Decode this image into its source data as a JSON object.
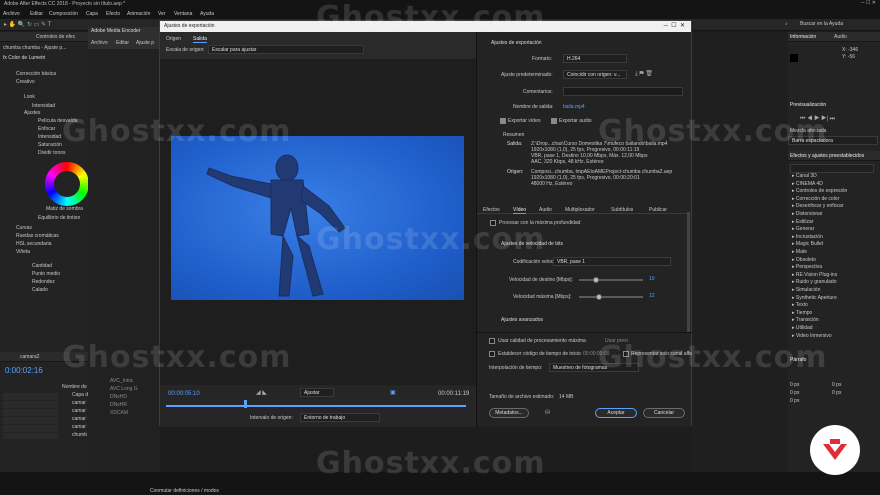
{
  "app": {
    "title": "Adobe After Effects CC 2018 - Proyecto sin título.aep *",
    "menu": [
      "Archivo",
      "Editar",
      "Composición",
      "Capa",
      "Efecto",
      "Animación",
      "Ver",
      "Ventana",
      "Ayuda"
    ],
    "search_placeholder": "Buscar en la Ayuda"
  },
  "ame": {
    "title": "Adobe Media Encoder",
    "menu": [
      "Archivo",
      "Editar",
      "Ajuste p"
    ]
  },
  "effects": {
    "tab": "Controles de efec",
    "breadcrumb": "chumba chumba - Ajuste p...",
    "effect": "Color de Lumetri",
    "items": [
      "Corrección básica",
      "Creativo",
      "Look",
      "Intensidad",
      "Ajustes",
      "Película desvaída",
      "Enfocar",
      "Intensidad",
      "Saturación",
      "Dividir tonos",
      "Matiz de sombra",
      "Equilibrio de tintion",
      "Curvas",
      "Ruedas cromáticas",
      "HSL secundaria",
      "Viñeta",
      "Cantidad",
      "Punto medio",
      "Redondez",
      "Calado"
    ]
  },
  "dialog": {
    "title": "Ajustes de exportación",
    "tabs": [
      "Origen",
      "Salida"
    ],
    "scale_label": "Escala de origen:",
    "scale_value": "Escalar para ajustar",
    "tc_start": "00:00:05:10",
    "tc_end": "00:00:11:19",
    "fit": "Ajustar",
    "range_label": "Intervalo de origen:",
    "range_value": "Entorno de trabajo",
    "section": "Ajustes de exportación",
    "format_label": "Formato:",
    "format_value": "H.264",
    "preset_label": "Ajuste predeterminado:",
    "preset_value": "Coincidir con origen: v...",
    "comments_label": "Comentarios:",
    "output_label": "Nombre de salida:",
    "output_value": "baila.mp4",
    "export_video": "Exportar vídeo",
    "export_audio": "Exportar audio",
    "summary_title": "Resumen",
    "out_label": "Salida:",
    "out_lines": [
      "Z:\\Drop...chas\\Curso Domestika 7\\mufeco bailando\\baila.mp4",
      "1920x1080 (1,0), 25 fps, Progresivo, 00:00:11:19",
      "VBR, pase 1, Destino 10,00 Mbps, Máx. 12,00 Mbps",
      "AAC, 320 Kbps, 48 kHz, Estéreo"
    ],
    "src_label": "Origen:",
    "src_lines": [
      "Composi...chumba, tmpAEtoAMEProject-chumba chumba2.aep",
      "1920x1080 (1,0), 25 fps, Progresivo, 00:00:20:01",
      "48000 Hz, Estéreo"
    ],
    "tabs2": [
      "Efectos",
      "Vídeo",
      "Audio",
      "Multiplexador",
      "Subtítulos",
      "Publicar"
    ],
    "proc_depth": "Procesar con la máxima profundidad",
    "bitrate_title": "Ajustes de velocidad de bits",
    "bitrate_cod_label": "Codificación velocidad:",
    "bitrate_cod_value": "VBR, pase 1",
    "target_label": "Velocidad de destino [Mbps]:",
    "target_value": "10",
    "max_label": "Velocidad máxima [Mbps]:",
    "max_value": "12",
    "advanced": "Ajustes avanzados",
    "max_quality": "Usar calidad de procesamiento máxima",
    "preview_label": "Usar previ",
    "tc_label": "Establecer código de tiempo de inicio",
    "tc_value": "00:00:00:00",
    "alpha_label": "Representar solo canal alfa",
    "interp_label": "Interpolación de tiempo:",
    "interp_value": "Muestreo de fotogramas",
    "size_label": "Tamaño de archivo estimado:",
    "size_value": "14 MB",
    "metadata": "Metadatos...",
    "accept": "Aceptar",
    "cancel": "Cancelar"
  },
  "right": {
    "info_tab": "Información",
    "audio_tab": "Audio",
    "x": "X: -346",
    "y": "Y: -56",
    "preview_tab": "Previsualización",
    "search": "Mezcla afectada",
    "search2": "Barra espaciadora",
    "effects_title": "Efectos y ajustes preestablecidos",
    "effects_list": [
      "Canal 3D",
      "CINEMA 4D",
      "Controles de expresión",
      "Corrección de color",
      "Desenfocar y enfocar",
      "Distorsionar",
      "Estilizar",
      "Generar",
      "Incrustación",
      "Magic Bullet",
      "Mate",
      "Obsoleto",
      "Perspectiva",
      "RE:Vision Plug-ins",
      "Ruido y granulado",
      "Simulación",
      "Synthetic Aperture",
      "Texto",
      "Tiempo",
      "Transición",
      "Utilidad",
      "Video Inmersivo"
    ],
    "parrafo": "Párrafo",
    "px_values": [
      "0 px",
      "0 px",
      "0 px",
      "0 px",
      "0 px"
    ]
  },
  "timeline": {
    "tab": "camara2",
    "timecode": "0:00:02:16",
    "col_name": "Nombre de la",
    "rows": [
      "Capa d",
      "camar",
      "camar",
      "camar",
      "camar",
      "chumb"
    ],
    "render_text": "Conmutar definiciones / modos",
    "formats": [
      "AVC_Intra",
      "AVC Long G",
      "DNxHD",
      "DNxHR",
      "XDCAM"
    ]
  },
  "watermark": "Ghostxx.com"
}
